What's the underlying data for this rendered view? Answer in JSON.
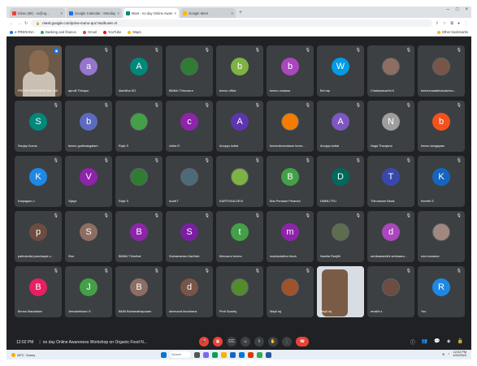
{
  "browser": {
    "tabs": [
      {
        "label": "Inbox (88) - ru@ng...",
        "color": "#ea4335"
      },
      {
        "label": "Google Calendar - Monday, 6th",
        "color": "#1a73e8"
      },
      {
        "label": "Meet - no day Online Aware",
        "color": "#00897b",
        "active": true
      },
      {
        "label": "Google Meet",
        "color": "#fbbc04"
      }
    ],
    "new_tab": "+",
    "url": "meet.google.com/pmw-numo-quc?authuser=0",
    "bookmarks": [
      "e-PRERANA",
      "Banking and finance",
      "Gmail",
      "YouTube",
      "Maps"
    ],
    "other_bookmarks": "Other bookmarks"
  },
  "participants": [
    {
      "name": "PRITHVI BENGERKOUL MA",
      "initial": "",
      "color": "#6b5a4a",
      "type": "video"
    },
    {
      "name": "aprofil Thirupur",
      "initial": "a",
      "color": "#9575cd"
    },
    {
      "name": "Akshitha SG",
      "initial": "A",
      "color": "#00897b"
    },
    {
      "name": "BMMU Thiruvarur",
      "initial": "",
      "color": "#2e7d32",
      "type": "img"
    },
    {
      "name": "bmmu office",
      "initial": "b",
      "color": "#7cb342"
    },
    {
      "name": "bmmu mulanur",
      "initial": "b",
      "color": "#ab47bc"
    },
    {
      "name": "Bnl rap",
      "initial": "W",
      "color": "#039be5"
    },
    {
      "name": "Chakkaravarthi K",
      "initial": "",
      "color": "#8d6e63",
      "type": "img"
    },
    {
      "name": "bmmumadathukulambu...",
      "initial": "",
      "color": "#795548",
      "type": "img"
    },
    {
      "name": "Sanjay Kumar",
      "initial": "S",
      "color": "#00897b"
    },
    {
      "name": "bmmu gudimangalam",
      "initial": "b",
      "color": "#5c6bc0"
    },
    {
      "name": "Rajiv S",
      "initial": "",
      "color": "#43a047",
      "type": "img"
    },
    {
      "name": "chitra R",
      "initial": "c",
      "color": "#8e24aa"
    },
    {
      "name": "Anuppu kottai",
      "initial": "A",
      "color": "#5e35b1"
    },
    {
      "name": "bmmmkmmulanur bmm...",
      "initial": "",
      "color": "#f57c00",
      "type": "img"
    },
    {
      "name": "Anuppu kottai",
      "initial": "A",
      "color": "#7e57c2"
    },
    {
      "name": "Naga Thanjavur",
      "initial": "N",
      "color": "#9e9e9e"
    },
    {
      "name": "bmmu kangayam",
      "initial": "b",
      "color": "#f4511e"
    },
    {
      "name": "Karpagam J",
      "initial": "K",
      "color": "#1e88e5"
    },
    {
      "name": "Vijaya",
      "initial": "V",
      "color": "#8e24aa"
    },
    {
      "name": "Rajiv S",
      "initial": "",
      "color": "#2e7d32",
      "type": "img"
    },
    {
      "name": "Audit T",
      "initial": "",
      "color": "#4e6a7a",
      "type": "img"
    },
    {
      "name": "KARTHIGA DEVI",
      "initial": "",
      "color": "#7cb342",
      "type": "img"
    },
    {
      "name": "Bdo Perarani Perarani",
      "initial": "B",
      "color": "#43a047"
    },
    {
      "name": "DMMU TRJ",
      "initial": "D",
      "color": "#00695c"
    },
    {
      "name": "Thiruvarum Block",
      "initial": "T",
      "color": "#3949ab"
    },
    {
      "name": "Keerthi S",
      "initial": "K",
      "color": "#1565c0"
    },
    {
      "name": "pathukottai panchayat u...",
      "initial": "p",
      "color": "#6d4c41"
    },
    {
      "name": "Star",
      "initial": "S",
      "color": "#8d6e63"
    },
    {
      "name": "BMMU Thiruthal",
      "initial": "B",
      "color": "#8e24aa"
    },
    {
      "name": "Subramanian Karthick",
      "initial": "S",
      "color": "#7b1fa2"
    },
    {
      "name": "thiruvarur bmmu",
      "initial": "t",
      "color": "#43a047"
    },
    {
      "name": "mudukulathur block",
      "initial": "m",
      "color": "#8e24aa"
    },
    {
      "name": "Namita Ranjith",
      "initial": "",
      "color": "#5d6e4e",
      "type": "img"
    },
    {
      "name": "sevikaaranidhi sevikaara...",
      "initial": "d",
      "color": "#ab47bc"
    },
    {
      "name": "siva kumaran",
      "initial": "",
      "color": "#a1887f",
      "type": "img"
    },
    {
      "name": "Bmmu Mandalam",
      "initial": "B",
      "color": "#e91e63"
    },
    {
      "name": "Jeevanthiham G",
      "initial": "J",
      "color": "#43a047"
    },
    {
      "name": "BMM Ramanathapuram",
      "initial": "B",
      "color": "#8d6e63"
    },
    {
      "name": "dmmumd tiruchirans",
      "initial": "d",
      "color": "#795548"
    },
    {
      "name": "Pmb Society",
      "initial": "",
      "color": "#558b2f",
      "type": "img"
    },
    {
      "name": "Mayil raj",
      "initial": "",
      "color": "#a0522d",
      "type": "img"
    },
    {
      "name": "Mayil raj",
      "initial": "",
      "color": "#d8dde3",
      "type": "video2"
    },
    {
      "name": "revathi s",
      "initial": "",
      "color": "#6d4c41",
      "type": "img"
    },
    {
      "name": "You",
      "initial": "R",
      "color": "#1e88e5"
    }
  ],
  "meeting": {
    "time": "12:02 PM",
    "separator": "|",
    "title": "no day Online Awareness Workshop on Organic Food N...",
    "control_icons": [
      "mic-off",
      "camera-off",
      "captions",
      "emoji",
      "present",
      "raise-hand",
      "more"
    ],
    "right_icons": [
      "info",
      "people",
      "chat",
      "activities",
      "lock"
    ]
  },
  "taskbar": {
    "weather_temp": "28°C",
    "weather_desc": "Sunny",
    "search": "Search",
    "time": "12:02 PM",
    "date": "1/20/2023"
  },
  "colors": {
    "meet_bg": "#202124",
    "tile_bg": "#3c4043",
    "end_call": "#ea4335"
  }
}
